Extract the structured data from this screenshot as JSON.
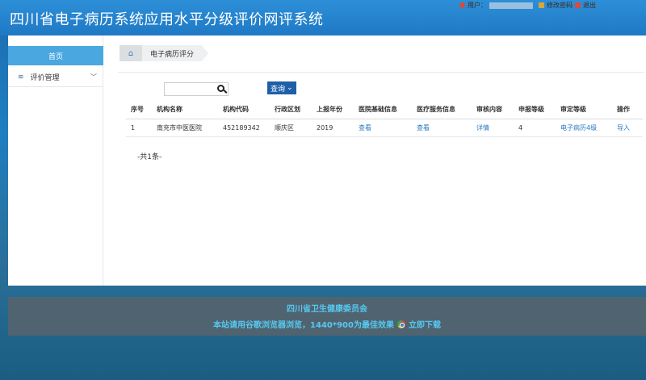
{
  "header": {
    "title": "四川省电子病历系统应用水平分级评价网评系统",
    "user_label": "用户：",
    "change_password": "修改密码",
    "logout": "退出"
  },
  "sidebar": {
    "items": [
      {
        "label": "首页",
        "icon": ""
      },
      {
        "label": "评价管理",
        "icon": "menu-icon",
        "chevron": "﹀"
      }
    ]
  },
  "breadcrumb": {
    "home_icon": "⌂",
    "current": "电子病历评分"
  },
  "search": {
    "value": "",
    "query_button": "查询",
    "query_arrow": "⌄"
  },
  "table": {
    "headers": [
      "序号",
      "机构名称",
      "机构代码",
      "行政区划",
      "上报年份",
      "医院基础信息",
      "医疗服务信息",
      "审核内容",
      "申报等级",
      "审定等级",
      "操作"
    ],
    "rows": [
      [
        "1",
        "南充市中医医院",
        "452189342",
        "顺庆区",
        "2019",
        "查看",
        "查看",
        "详情",
        "4",
        "电子病历4级",
        "导入"
      ]
    ],
    "total": "-共1条-"
  },
  "footer": {
    "line1": "四川省卫生健康委员会",
    "line2": "本站请用谷歌浏览器浏览，1440*900为最佳效果",
    "download": "立即下载"
  },
  "colors": {
    "header_bg": "#1f79c4",
    "accent": "#4aa7e0",
    "link": "#2a78c4",
    "query_button": "#1f5fa8",
    "footer_text": "#56c8f0"
  }
}
